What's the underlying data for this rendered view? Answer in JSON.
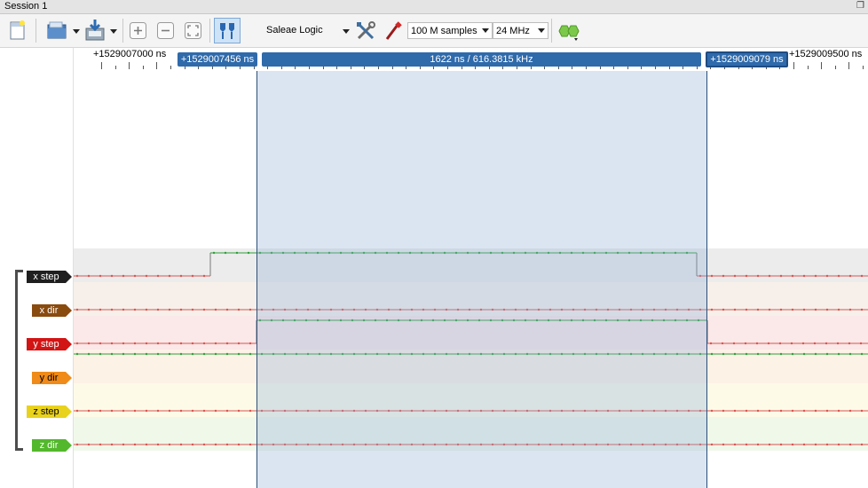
{
  "window": {
    "title": "Session 1"
  },
  "toolbar": {
    "device_label": "Saleae Logic",
    "samples": "100 M samples",
    "rate": "24 MHz"
  },
  "ruler": {
    "left_time": "+1529007000 ns",
    "right_time": "+1529009500 ns",
    "start_marker": "+1529007456 ns",
    "width_marker": "1622 ns / 616.3815 kHz",
    "end_marker": "+1529009079 ns"
  },
  "channels": [
    {
      "name": "x step",
      "color": "#1f1f1f"
    },
    {
      "name": "x dir",
      "color": "#8a4b0f"
    },
    {
      "name": "y step",
      "color": "#d21414"
    },
    {
      "name": "y dir",
      "color": "#f08a18"
    },
    {
      "name": "z step",
      "color": "#e9d21c"
    },
    {
      "name": "z dir",
      "color": "#53b82c"
    }
  ],
  "colors": {
    "selection": "#8fafd8",
    "marker": "#2f6aab",
    "signal_low": "#d9534f",
    "signal_high": "#2e9e3a"
  }
}
